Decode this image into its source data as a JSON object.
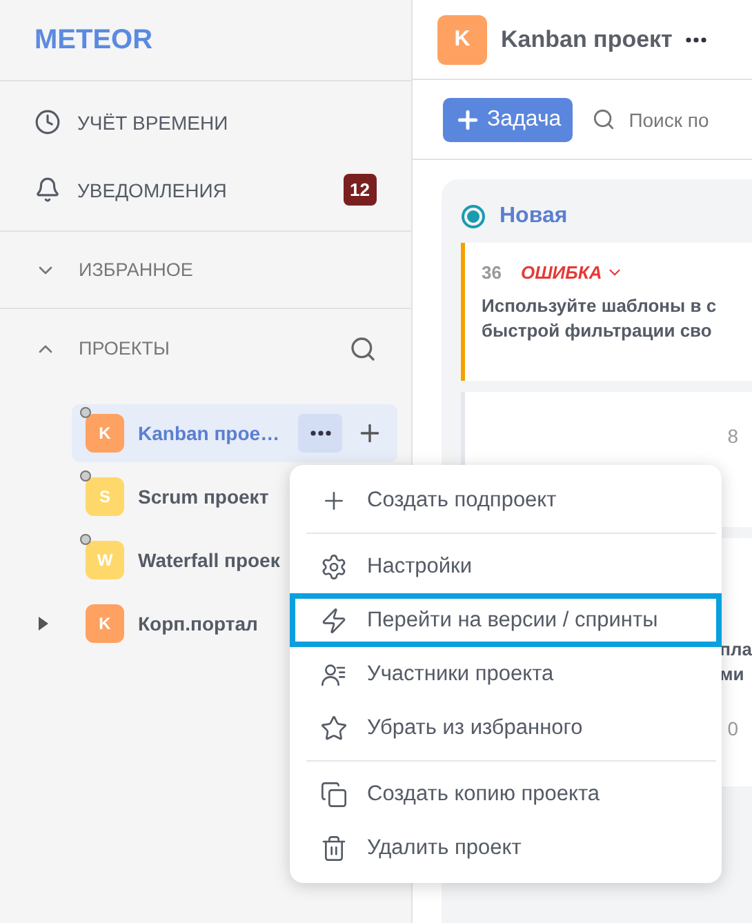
{
  "logo": "METEOR",
  "nav": [
    {
      "label": "УЧЁТ ВРЕМЕНИ",
      "kind": "clock"
    },
    {
      "label": "УВЕДОМЛЕНИЯ",
      "kind": "bell",
      "badge": "12"
    }
  ],
  "sections": [
    {
      "label": "ИЗБРАННОЕ",
      "expanded": false,
      "search": false
    },
    {
      "label": "ПРОЕКТЫ",
      "expanded": true,
      "search": true
    }
  ],
  "projects": [
    {
      "letter": "K",
      "name": "Kanban прое…",
      "color": "#ffa161",
      "selected": true,
      "pinned": true,
      "has_children": false
    },
    {
      "letter": "S",
      "name": "Scrum проект",
      "color": "#ffd86b",
      "selected": false,
      "pinned": true,
      "has_children": false
    },
    {
      "letter": "W",
      "name": "Waterfall проек",
      "color": "#ffd86b",
      "selected": false,
      "pinned": true,
      "has_children": false
    },
    {
      "letter": "K",
      "name": "Корп.портал",
      "color": "#ffa161",
      "selected": false,
      "pinned": false,
      "has_children": true
    }
  ],
  "header": {
    "letter": "K",
    "title": "Kanban проект",
    "color": "#ffa161"
  },
  "toolbar": {
    "add_button": "Задача",
    "search_placeholder": "Поиск по"
  },
  "board": {
    "column": "Новая",
    "cards": [
      {
        "number": "36",
        "tag": "ОШИБКА",
        "text": "Используйте шаблоны в с\nбыстрой фильтрации сво"
      },
      {
        "count": "8"
      },
      {
        "text": "пла\nми",
        "count": "0"
      }
    ]
  },
  "menu": [
    {
      "label": "Создать подпроект",
      "selected": false,
      "divider_after": true
    },
    {
      "label": "Настройки",
      "selected": false,
      "divider_after": false
    },
    {
      "label": "Перейти на версии / спринты",
      "selected": true,
      "divider_after": false
    },
    {
      "label": "Участники проекта",
      "selected": false,
      "divider_after": false
    },
    {
      "label": "Убрать из избранного",
      "selected": false,
      "divider_after": true
    },
    {
      "label": "Создать копию проекта",
      "selected": false,
      "divider_after": false
    },
    {
      "label": "Удалить проект",
      "selected": false,
      "divider_after": false
    }
  ]
}
